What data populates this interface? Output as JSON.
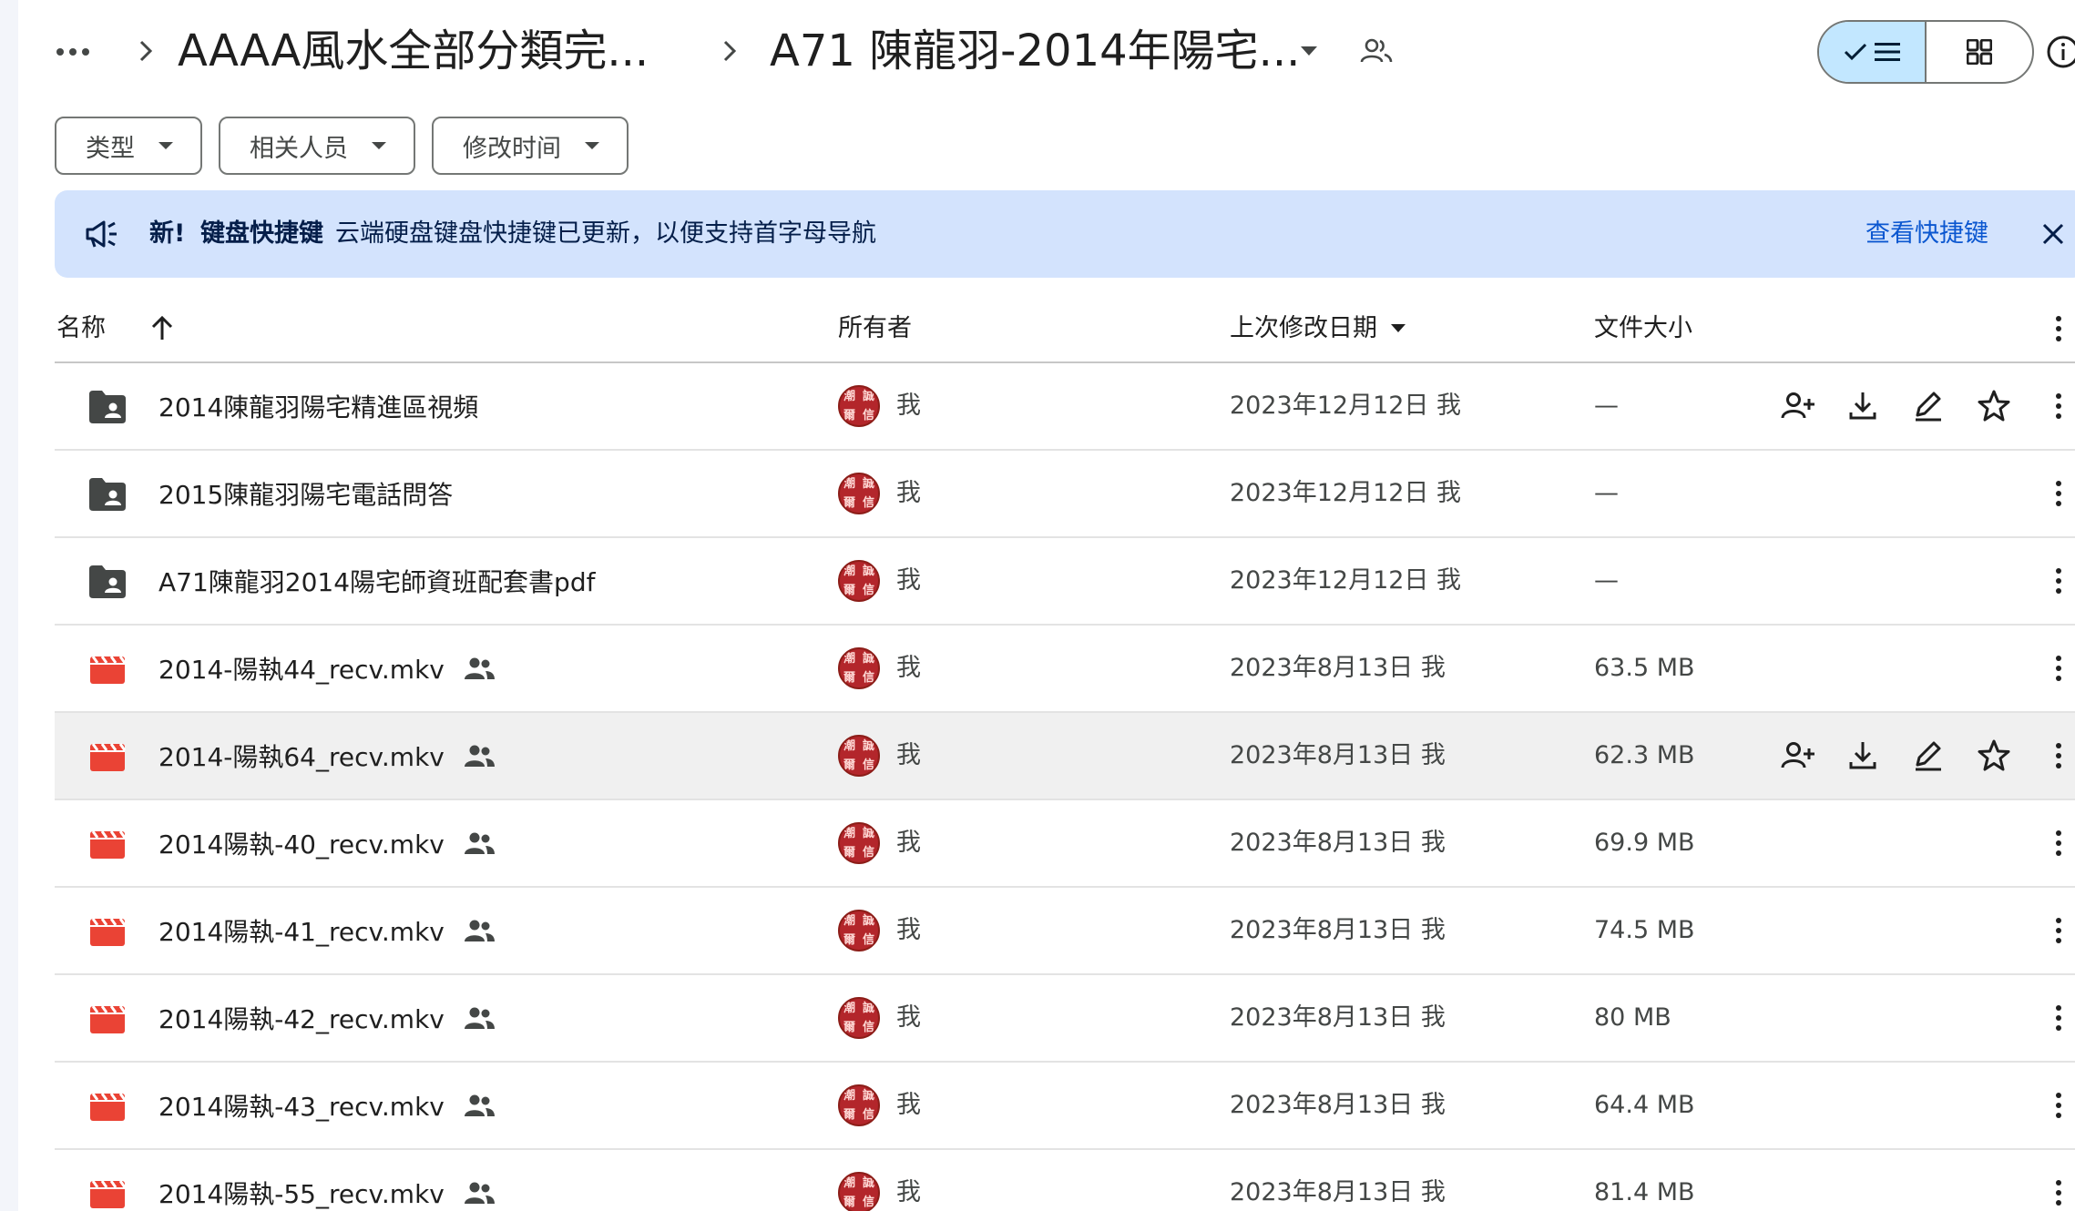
{
  "breadcrumb": {
    "parent": "AAAA風水全部分類完...",
    "current": "A71 陳龍羽-2014年陽宅..."
  },
  "filters": [
    {
      "label": "类型"
    },
    {
      "label": "相关人员"
    },
    {
      "label": "修改时间"
    }
  ],
  "banner": {
    "new_label": "新!",
    "title": "键盘快捷键",
    "message": "云端硬盘键盘快捷键已更新，以便支持首字母导航",
    "link": "查看快捷键"
  },
  "columns": {
    "name": "名称",
    "owner": "所有者",
    "modified": "上次修改日期",
    "size": "文件大小"
  },
  "avatar_chars": [
    "潮",
    "誠",
    "爾",
    "信"
  ],
  "files": [
    {
      "name": "2014陳龍羽陽宅精進區視頻",
      "type": "shared-folder",
      "owner": "我",
      "modified": "2023年12月12日 我",
      "size": "—",
      "shared": false,
      "hover_actions": true
    },
    {
      "name": "2015陳龍羽陽宅電話問答",
      "type": "shared-folder",
      "owner": "我",
      "modified": "2023年12月12日 我",
      "size": "—",
      "shared": false,
      "hover_actions": false
    },
    {
      "name": "A71陳龍羽2014陽宅師資班配套書pdf",
      "type": "shared-folder",
      "owner": "我",
      "modified": "2023年12月12日 我",
      "size": "—",
      "shared": false,
      "hover_actions": false
    },
    {
      "name": "2014-陽執44_recv.mkv",
      "type": "video",
      "owner": "我",
      "modified": "2023年8月13日 我",
      "size": "63.5 MB",
      "shared": true,
      "hover_actions": false
    },
    {
      "name": "2014-陽執64_recv.mkv",
      "type": "video",
      "owner": "我",
      "modified": "2023年8月13日 我",
      "size": "62.3 MB",
      "shared": true,
      "hover_actions": true,
      "hovered": true
    },
    {
      "name": "2014陽執-40_recv.mkv",
      "type": "video",
      "owner": "我",
      "modified": "2023年8月13日 我",
      "size": "69.9 MB",
      "shared": true,
      "hover_actions": false
    },
    {
      "name": "2014陽執-41_recv.mkv",
      "type": "video",
      "owner": "我",
      "modified": "2023年8月13日 我",
      "size": "74.5 MB",
      "shared": true,
      "hover_actions": false
    },
    {
      "name": "2014陽執-42_recv.mkv",
      "type": "video",
      "owner": "我",
      "modified": "2023年8月13日 我",
      "size": "80 MB",
      "shared": true,
      "hover_actions": false
    },
    {
      "name": "2014陽執-43_recv.mkv",
      "type": "video",
      "owner": "我",
      "modified": "2023年8月13日 我",
      "size": "64.4 MB",
      "shared": true,
      "hover_actions": false
    },
    {
      "name": "2014陽執-55_recv.mkv",
      "type": "video",
      "owner": "我",
      "modified": "2023年8月13日 我",
      "size": "81.4 MB",
      "shared": true,
      "hover_actions": false
    }
  ],
  "colors": {
    "accent": "#0b57d0",
    "banner_bg": "#d3e3fd",
    "toggle_active": "#c2e7ff",
    "video_icon": "#ea4335",
    "avatar": "#b3262b"
  }
}
